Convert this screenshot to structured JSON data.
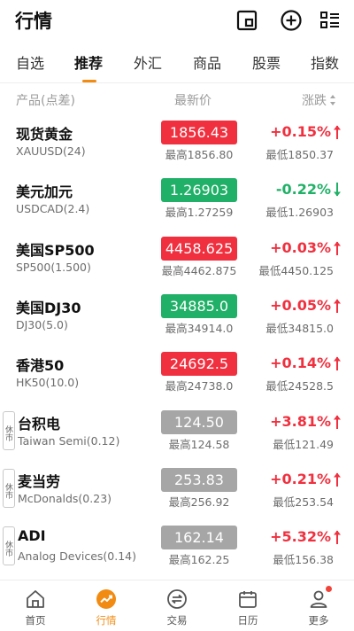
{
  "header": {
    "title": "行情"
  },
  "tabs": [
    "自选",
    "推荐",
    "外汇",
    "商品",
    "股票",
    "指数"
  ],
  "columns": {
    "product": "产品(点差)",
    "latest": "最新价",
    "change": "涨跌"
  },
  "colors": {
    "up": "#f0303f",
    "down": "#20b067",
    "closed": "#a6a6a6",
    "accent": "#f28b12"
  },
  "rows": [
    {
      "name": "现货黄金",
      "code": "XAUUSD(24)",
      "price": "1856.43",
      "high": "最高1856.80",
      "change": "+0.15%",
      "low": "最低1850.37",
      "trend": "up",
      "closed": false
    },
    {
      "name": "美元加元",
      "code": "USDCAD(2.4)",
      "price": "1.26903",
      "high": "最高1.27259",
      "change": "-0.22%",
      "low": "最低1.26903",
      "trend": "down",
      "closed": false
    },
    {
      "name": "美国SP500",
      "code": "SP500(1.500)",
      "price": "4458.625",
      "high": "最高4462.875",
      "change": "+0.03%",
      "low": "最低4450.125",
      "trend": "up",
      "closed": false
    },
    {
      "name": "美国DJ30",
      "code": "DJ30(5.0)",
      "price": "34885.0",
      "high": "最高34914.0",
      "change": "+0.05%",
      "low": "最低34815.0",
      "trend": "up",
      "closed": false,
      "price_color": "down"
    },
    {
      "name": "香港50",
      "code": "HK50(10.0)",
      "price": "24692.5",
      "high": "最高24738.0",
      "change": "+0.14%",
      "low": "最低24528.5",
      "trend": "up",
      "closed": false
    },
    {
      "name": "台积电",
      "code": "Taiwan Semi(0.12)",
      "price": "124.50",
      "high": "最高124.58",
      "change": "+3.81%",
      "low": "最低121.49",
      "trend": "up",
      "closed": true
    },
    {
      "name": "麦当劳",
      "code": "McDonalds(0.23)",
      "price": "253.83",
      "high": "最高256.92",
      "change": "+0.21%",
      "low": "最低253.54",
      "trend": "up",
      "closed": true
    },
    {
      "name": "ADI",
      "code": "Analog Devices(0.14)",
      "price": "162.14",
      "high": "最高162.25",
      "change": "+5.32%",
      "low": "最低156.38",
      "trend": "up",
      "closed": true
    }
  ],
  "closed_badge": "休市",
  "nav": [
    {
      "label": "首页",
      "icon": "home-icon"
    },
    {
      "label": "行情",
      "icon": "chart-trend-icon"
    },
    {
      "label": "交易",
      "icon": "exchange-icon"
    },
    {
      "label": "日历",
      "icon": "calendar-icon"
    },
    {
      "label": "更多",
      "icon": "user-icon"
    }
  ]
}
